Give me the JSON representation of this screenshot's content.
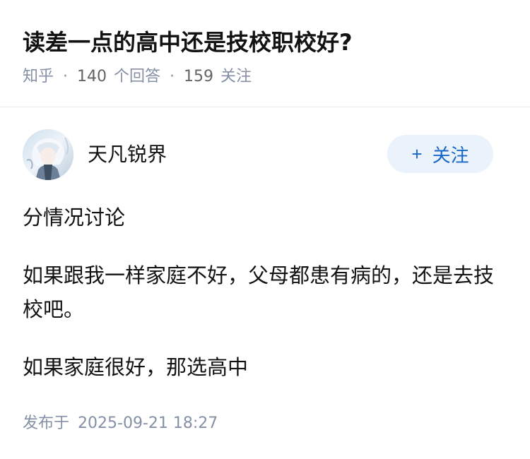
{
  "question": {
    "title": "读差一点的高中还是技校职校好?",
    "source": "知乎",
    "separator": "·",
    "answer_count": "140",
    "answer_label": "个回答",
    "follower_count": "159",
    "follower_label": "关注"
  },
  "author": {
    "name": "天凡锐界",
    "avatar_icon": "avatar-image",
    "follow_plus": "+",
    "follow_label": "关注"
  },
  "answer": {
    "paragraphs": [
      "分情况讨论",
      "如果跟我一样家庭不好，父母都患有病的，还是去技校吧。",
      "如果家庭很好，那选高中"
    ],
    "publish_label": "发布于",
    "publish_time": "2025-09-21 18:27"
  },
  "colors": {
    "accent": "#1767c9",
    "follow_bg": "#eaf2fb",
    "meta": "#8590a6",
    "text": "#121212"
  }
}
